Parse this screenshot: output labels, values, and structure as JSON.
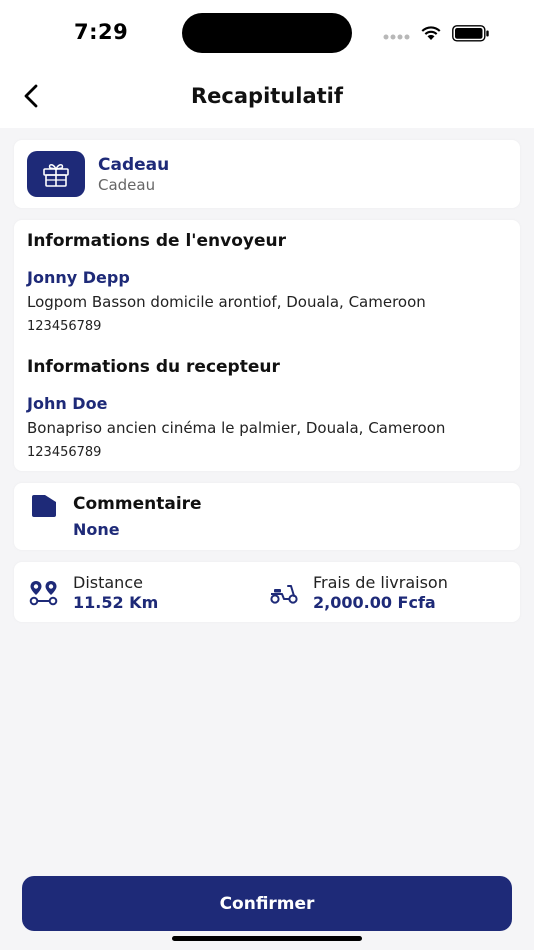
{
  "status_bar": {
    "time": "7:29",
    "icons": [
      "signal-icon",
      "wifi-icon",
      "battery-icon"
    ]
  },
  "header": {
    "title": "Recapitulatif",
    "back_icon": "chevron-left-icon"
  },
  "category": {
    "icon": "gift-icon",
    "title": "Cadeau",
    "subtitle": "Cadeau"
  },
  "sender": {
    "section_title": "Informations de l'envoyeur",
    "name": "Jonny Depp",
    "address": "Logpom Basson domicile arontiof, Douala, Cameroon",
    "phone": "123456789"
  },
  "receiver": {
    "section_title": "Informations du recepteur",
    "name": "John Doe",
    "address": "Bonapriso ancien cinéma le palmier, Douala, Cameroon",
    "phone": "123456789"
  },
  "comment": {
    "icon": "folder-icon",
    "title": "Commentaire",
    "value": "None"
  },
  "metrics": {
    "distance": {
      "icon": "route-icon",
      "label": "Distance",
      "value": "11.52 Km"
    },
    "fee": {
      "icon": "scooter-icon",
      "label": "Frais de livraison",
      "value": "2,000.00 Fcfa"
    }
  },
  "actions": {
    "confirm_label": "Confirmer"
  },
  "colors": {
    "accent": "#1e2a78",
    "background": "#f5f5f7",
    "card": "#ffffff"
  }
}
